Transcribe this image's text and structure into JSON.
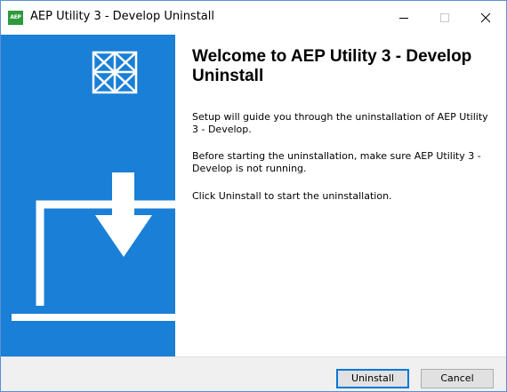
{
  "window": {
    "title": "AEP Utility 3 - Develop Uninstall",
    "app_icon_text": "AEP"
  },
  "content": {
    "heading": "Welcome to AEP Utility 3 - Develop Uninstall",
    "paragraphs": [
      "Setup will guide you through the uninstallation of AEP Utility 3 - Develop.",
      "Before starting the uninstallation, make sure AEP Utility 3 - Develop is not running.",
      "Click Uninstall to start the uninstallation."
    ]
  },
  "buttons": {
    "uninstall": "Uninstall",
    "cancel": "Cancel"
  },
  "icons": {
    "app": "aep-app-icon",
    "minimize": "minimize-icon",
    "maximize": "maximize-icon",
    "close": "close-icon",
    "logo": "installer-logo-icon",
    "laptop": "laptop-download-icon"
  },
  "colors": {
    "sidebar": "#1a7fd6",
    "accent": "#0078d7",
    "footer": "#f0f0f0",
    "app_icon": "#2e9a3b"
  }
}
